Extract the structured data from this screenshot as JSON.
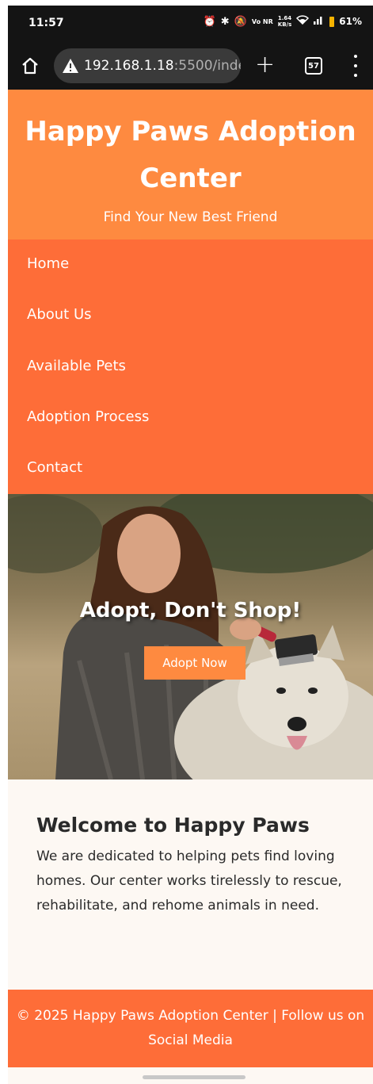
{
  "status_bar": {
    "time": "11:57",
    "alarm_icon": "alarm-icon",
    "bluetooth_icon": "bluetooth-icon",
    "mute_icon": "notifications-off-icon",
    "network_label": "Vo NR",
    "speed_value": "1.64",
    "speed_unit": "KB/s",
    "wifi_icon": "wifi-icon",
    "signal_icon": "signal-icon",
    "battery_percent": "61%",
    "battery_color": "#f5b300"
  },
  "browser": {
    "home_icon": "home-icon",
    "warning_icon": "warning-icon",
    "url_host": "192.168.1.18",
    "url_path": ":5500/inde",
    "new_tab_symbol": "+",
    "tab_count": "57",
    "menu_icon": "more-vert-icon"
  },
  "header": {
    "title": "Happy Paws Adoption Center",
    "subtitle": "Find Your New Best Friend",
    "bg_color": "#fe8a40"
  },
  "nav": {
    "bg_color": "#fe6d38",
    "items": [
      {
        "label": "Home"
      },
      {
        "label": "About Us"
      },
      {
        "label": "Available Pets"
      },
      {
        "label": "Adoption Process"
      },
      {
        "label": "Contact"
      }
    ]
  },
  "hero": {
    "heading": "Adopt, Don't Shop!",
    "button_label": "Adopt Now",
    "image_subject": "woman brushing a white husky dog outdoors"
  },
  "welcome": {
    "heading": "Welcome to Happy Paws",
    "text": "We are dedicated to helping pets find loving homes. Our center works tirelessly to rescue, rehabilitate, and rehome animals in need."
  },
  "footer": {
    "text": "© 2025 Happy Paws Adoption Center | Follow us on Social Media",
    "bg_color": "#fe6d38"
  }
}
